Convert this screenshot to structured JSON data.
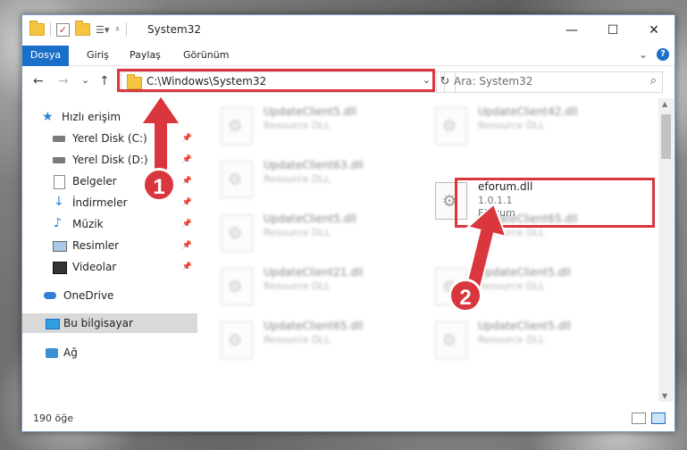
{
  "window": {
    "title": "System32"
  },
  "window_buttons": {
    "minimize": "—",
    "maximize": "☐",
    "close": "✕"
  },
  "ribbon": {
    "tabs": [
      "Dosya",
      "Giriş",
      "Paylaş",
      "Görünüm"
    ],
    "collapse": "⌄",
    "help": "?"
  },
  "toolbar": {
    "dropdown": "▾",
    "pin": "📌"
  },
  "nav_buttons": {
    "back": "←",
    "forward": "→",
    "recent": "⌄",
    "up": "↑"
  },
  "address": {
    "path": "C:\\Windows\\System32",
    "dropdown": "⌄",
    "refresh": "↻"
  },
  "search": {
    "placeholder": "Ara: System32",
    "icon": "⌕"
  },
  "sidebar": {
    "items": [
      {
        "label": "Hızlı erişim",
        "icon": "star-icon",
        "pinned": false
      },
      {
        "label": "Yerel Disk (C:)",
        "icon": "drive-icon",
        "pinned": true
      },
      {
        "label": "Yerel Disk (D:)",
        "icon": "drive-icon",
        "pinned": true
      },
      {
        "label": "Belgeler",
        "icon": "documents-icon",
        "pinned": true
      },
      {
        "label": "İndirmeler",
        "icon": "download-icon",
        "pinned": true
      },
      {
        "label": "Müzik",
        "icon": "music-icon",
        "pinned": true
      },
      {
        "label": "Resimler",
        "icon": "pictures-icon",
        "pinned": true
      },
      {
        "label": "Videolar",
        "icon": "videos-icon",
        "pinned": true
      },
      {
        "label": "OneDrive",
        "icon": "cloud-icon",
        "pinned": false
      },
      {
        "label": "Bu bilgisayar",
        "icon": "computer-icon",
        "pinned": false,
        "selected": true
      },
      {
        "label": "Ağ",
        "icon": "network-icon",
        "pinned": false
      }
    ],
    "pin_glyph": "📌"
  },
  "files": [
    {
      "name": "UpdateClient5.dll",
      "desc": "Resource DLL",
      "blurred": true
    },
    {
      "name": "UpdateClient42.dll",
      "desc": "Resource DLL",
      "blurred": true
    },
    {
      "name": "UpdateClient63.dll",
      "desc": "Resource DLL",
      "blurred": true
    },
    {
      "name": "eforum.dll",
      "desc": "1.0.1.1",
      "ext": "EForum",
      "blurred": false,
      "highlighted": true
    },
    {
      "name": "UpdateClient5.dll",
      "desc": "Resource DLL",
      "blurred": true
    },
    {
      "name": "UpdateClient65.dll",
      "desc": "Resource DLL",
      "blurred": true
    },
    {
      "name": "UpdateClient21.dll",
      "desc": "Resource DLL",
      "blurred": true
    },
    {
      "name": "UpdateClient5.dll",
      "desc": "Resource DLL",
      "blurred": true
    },
    {
      "name": "UpdateClient65.dll",
      "desc": "Resource DLL",
      "blurred": true
    },
    {
      "name": "UpdateClient5.dll",
      "desc": "Resource DLL",
      "blurred": true
    }
  ],
  "scrollbar": {
    "up": "▲",
    "down": "▼"
  },
  "status": {
    "count": "190 öğe"
  },
  "annotations": {
    "step1": "1",
    "step2": "2",
    "color": "#d9363e"
  }
}
